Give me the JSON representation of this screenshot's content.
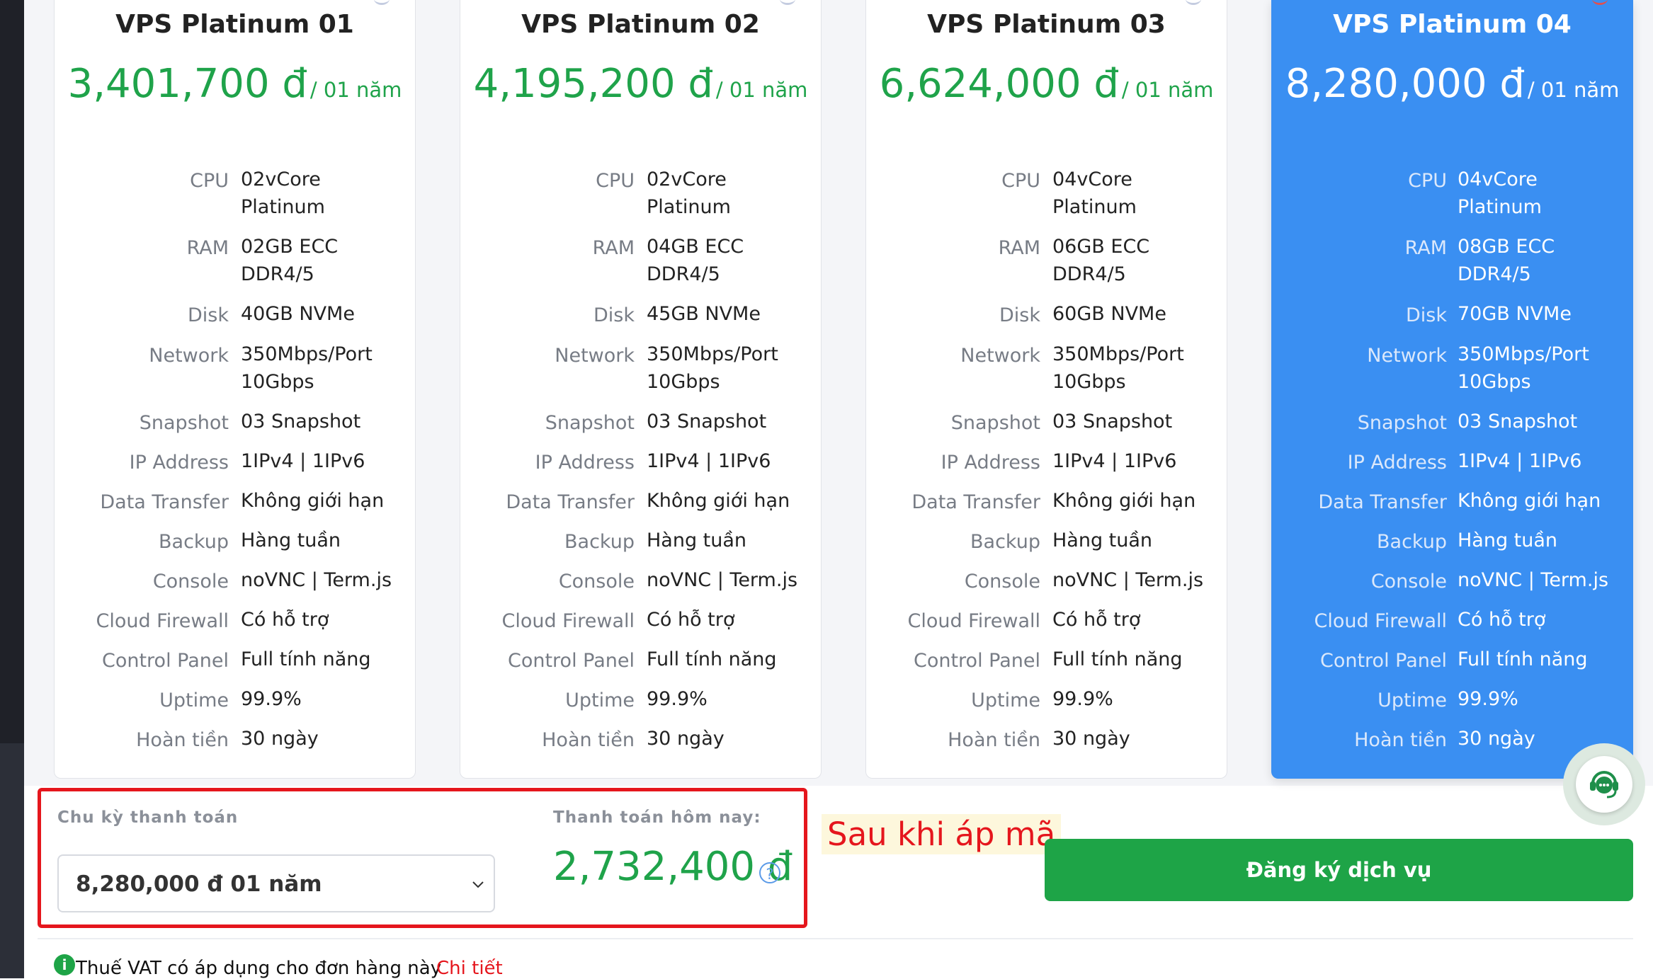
{
  "plans": [
    {
      "name": "VPS Platinum 01",
      "price": "3,401,700 đ",
      "period": "/ 01 năm",
      "specs": [
        {
          "label": "CPU",
          "value": "02vCore\nPlatinum"
        },
        {
          "label": "RAM",
          "value": "02GB ECC\nDDR4/5"
        },
        {
          "label": "Disk",
          "value": "40GB NVMe"
        },
        {
          "label": "Network",
          "value": "350Mbps/Port\n10Gbps"
        },
        {
          "label": "Snapshot",
          "value": "03 Snapshot"
        },
        {
          "label": "IP Address",
          "value": "1IPv4 | 1IPv6"
        },
        {
          "label": "Data Transfer",
          "value": "Không giới hạn"
        },
        {
          "label": "Backup",
          "value": "Hàng tuần"
        },
        {
          "label": "Console",
          "value": "noVNC | Term.js"
        },
        {
          "label": "Cloud Firewall",
          "value": "Có hỗ trợ"
        },
        {
          "label": "Control Panel",
          "value": "Full tính năng"
        },
        {
          "label": "Uptime",
          "value": "99.9%"
        },
        {
          "label": "Hoàn tiền",
          "value": "30 ngày"
        }
      ]
    },
    {
      "name": "VPS Platinum 02",
      "price": "4,195,200 đ",
      "period": "/ 01 năm",
      "specs": [
        {
          "label": "CPU",
          "value": "02vCore\nPlatinum"
        },
        {
          "label": "RAM",
          "value": "04GB ECC\nDDR4/5"
        },
        {
          "label": "Disk",
          "value": "45GB NVMe"
        },
        {
          "label": "Network",
          "value": "350Mbps/Port\n10Gbps"
        },
        {
          "label": "Snapshot",
          "value": "03 Snapshot"
        },
        {
          "label": "IP Address",
          "value": "1IPv4 | 1IPv6"
        },
        {
          "label": "Data Transfer",
          "value": "Không giới hạn"
        },
        {
          "label": "Backup",
          "value": "Hàng tuần"
        },
        {
          "label": "Console",
          "value": "noVNC | Term.js"
        },
        {
          "label": "Cloud Firewall",
          "value": "Có hỗ trợ"
        },
        {
          "label": "Control Panel",
          "value": "Full tính năng"
        },
        {
          "label": "Uptime",
          "value": "99.9%"
        },
        {
          "label": "Hoàn tiền",
          "value": "30 ngày"
        }
      ]
    },
    {
      "name": "VPS Platinum 03",
      "price": "6,624,000 đ",
      "period": "/ 01 năm",
      "specs": [
        {
          "label": "CPU",
          "value": "04vCore\nPlatinum"
        },
        {
          "label": "RAM",
          "value": "06GB ECC\nDDR4/5"
        },
        {
          "label": "Disk",
          "value": "60GB NVMe"
        },
        {
          "label": "Network",
          "value": "350Mbps/Port\n10Gbps"
        },
        {
          "label": "Snapshot",
          "value": "03 Snapshot"
        },
        {
          "label": "IP Address",
          "value": "1IPv4 | 1IPv6"
        },
        {
          "label": "Data Transfer",
          "value": "Không giới hạn"
        },
        {
          "label": "Backup",
          "value": "Hàng tuần"
        },
        {
          "label": "Console",
          "value": "noVNC | Term.js"
        },
        {
          "label": "Cloud Firewall",
          "value": "Có hỗ trợ"
        },
        {
          "label": "Control Panel",
          "value": "Full tính năng"
        },
        {
          "label": "Uptime",
          "value": "99.9%"
        },
        {
          "label": "Hoàn tiền",
          "value": "30 ngày"
        }
      ]
    },
    {
      "name": "VPS Platinum 04",
      "price": "8,280,000 đ",
      "period": "/ 01 năm",
      "specs": [
        {
          "label": "CPU",
          "value": "04vCore\nPlatinum"
        },
        {
          "label": "RAM",
          "value": "08GB ECC\nDDR4/5"
        },
        {
          "label": "Disk",
          "value": "70GB NVMe"
        },
        {
          "label": "Network",
          "value": "350Mbps/Port\n10Gbps"
        },
        {
          "label": "Snapshot",
          "value": "03 Snapshot"
        },
        {
          "label": "IP Address",
          "value": "1IPv4 | 1IPv6"
        },
        {
          "label": "Data Transfer",
          "value": "Không giới hạn"
        },
        {
          "label": "Backup",
          "value": "Hàng tuần"
        },
        {
          "label": "Console",
          "value": "noVNC | Term.js"
        },
        {
          "label": "Cloud Firewall",
          "value": "Có hỗ trợ"
        },
        {
          "label": "Control Panel",
          "value": "Full tính năng"
        },
        {
          "label": "Uptime",
          "value": "99.9%"
        },
        {
          "label": "Hoàn tiền",
          "value": "30 ngày"
        }
      ]
    }
  ],
  "selected_plan": "VPS Platinum 04",
  "billing": {
    "cycle_label": "Chu kỳ thanh toán",
    "cycle_value": "8,280,000 đ 01 năm",
    "pay_today_label": "Thanh toán hôm nay:",
    "pay_today_amount": "2,732,400 đ"
  },
  "annotation": {
    "note": "Sau khi áp mã"
  },
  "register_button": "Đăng ký dịch vụ",
  "vat": {
    "text": "Thuế VAT có áp dụng cho đơn hàng này",
    "link": "Chi tiết"
  },
  "icons": {
    "help": "question-circle-icon",
    "chevron": "chevron-down-icon",
    "chat": "support-chat-icon",
    "info": "info-circle-icon"
  },
  "colors": {
    "price_green": "#1fa34a",
    "featured_blue": "#3a8ff2",
    "highlight_red": "#e5161d",
    "register_green": "#1ea447",
    "note_bg": "#fdf7dc"
  }
}
